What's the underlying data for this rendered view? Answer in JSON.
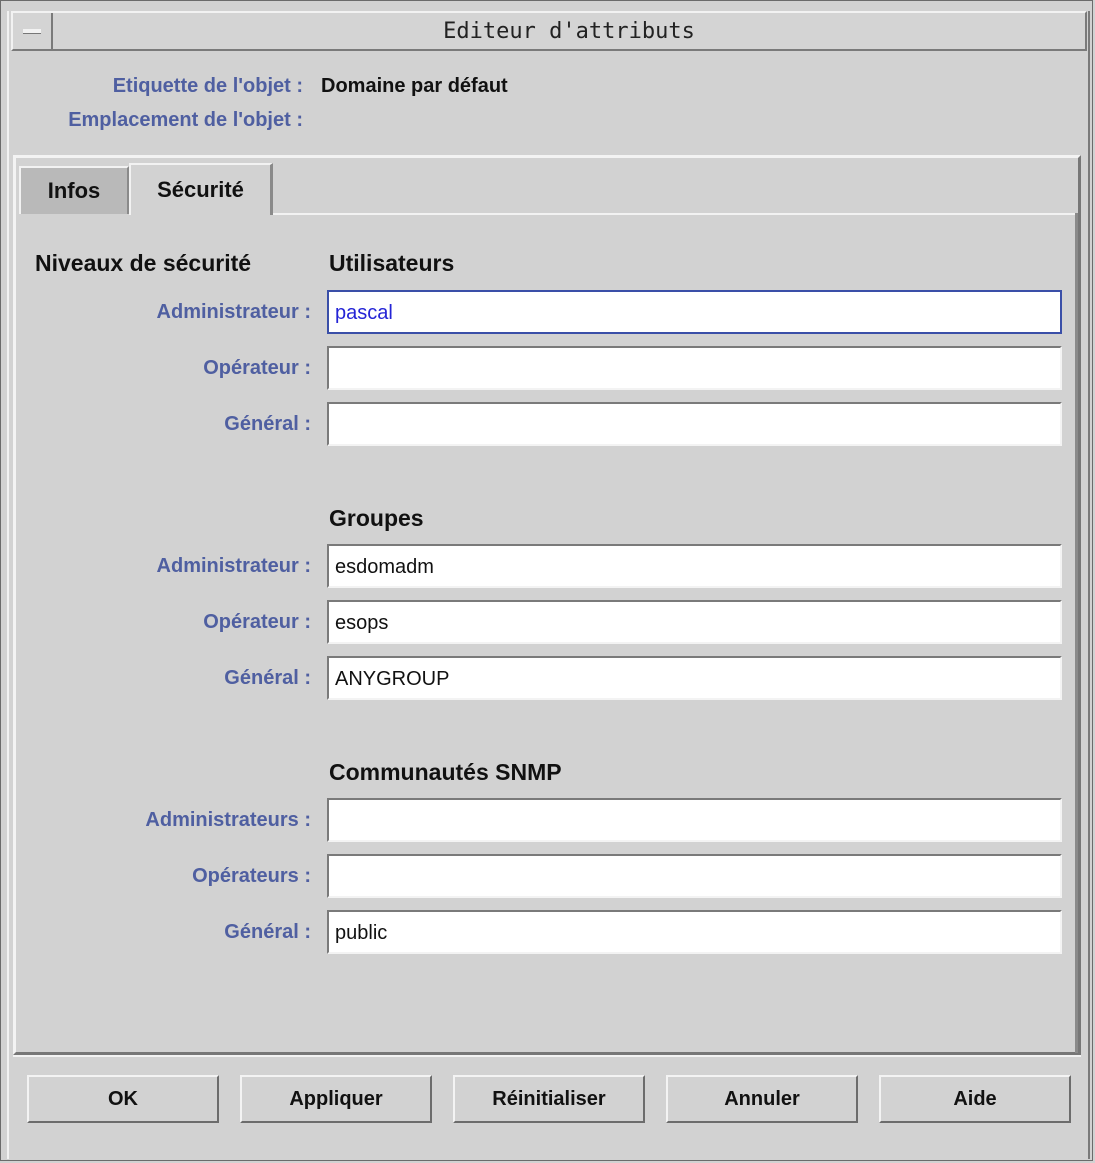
{
  "window": {
    "title": "Editeur d'attributs"
  },
  "header": {
    "object_label_caption": "Etiquette de l'objet :",
    "object_label_value": "Domaine par défaut",
    "object_location_caption": "Emplacement de l'objet :",
    "object_location_value": ""
  },
  "tabs": [
    {
      "label": "Infos",
      "active": false
    },
    {
      "label": "Sécurité",
      "active": true
    }
  ],
  "security": {
    "levels_title": "Niveaux de sécurité",
    "users": {
      "title": "Utilisateurs",
      "administrator_label": "Administrateur :",
      "administrator_value": "pascal",
      "operator_label": "Opérateur :",
      "operator_value": "",
      "general_label": "Général :",
      "general_value": ""
    },
    "groups": {
      "title": "Groupes",
      "administrator_label": "Administrateur :",
      "administrator_value": "esdomadm",
      "operator_label": "Opérateur :",
      "operator_value": "esops",
      "general_label": "Général :",
      "general_value": "ANYGROUP"
    },
    "snmp": {
      "title": "Communautés SNMP",
      "administrators_label": "Administrateurs :",
      "administrators_value": "",
      "operators_label": "Opérateurs :",
      "operators_value": "",
      "general_label": "Général :",
      "general_value": "public"
    }
  },
  "buttons": {
    "ok": "OK",
    "apply": "Appliquer",
    "reset": "Réinitialiser",
    "cancel": "Annuler",
    "help": "Aide"
  },
  "colors": {
    "label": "#4f5fa1",
    "background": "#d2d2d2",
    "focus": "#3a4fa8",
    "focused_text": "#2424d6"
  }
}
